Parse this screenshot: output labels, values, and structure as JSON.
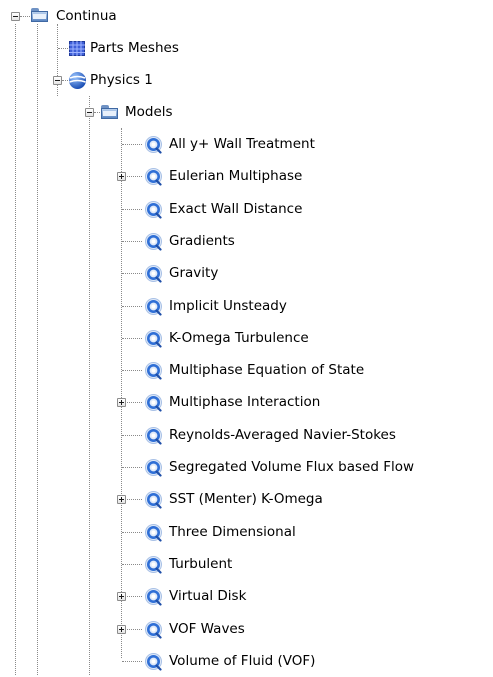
{
  "tree": {
    "continua": {
      "label": "Continua",
      "icon": "folder-icon",
      "expanded": true
    },
    "parts_meshes": {
      "label": "Parts Meshes",
      "icon": "grid-icon"
    },
    "physics": {
      "label": "Physics 1",
      "icon": "physics-sphere-icon",
      "expanded": true
    },
    "models": {
      "label": "Models",
      "icon": "folder-icon",
      "expanded": true
    },
    "model_items": [
      {
        "label": "All y+ Wall Treatment",
        "icon": "model-icon",
        "expandable": false
      },
      {
        "label": "Eulerian Multiphase",
        "icon": "model-icon",
        "expandable": true
      },
      {
        "label": "Exact Wall Distance",
        "icon": "model-icon",
        "expandable": false
      },
      {
        "label": "Gradients",
        "icon": "model-icon",
        "expandable": false
      },
      {
        "label": "Gravity",
        "icon": "model-icon",
        "expandable": false
      },
      {
        "label": "Implicit Unsteady",
        "icon": "model-icon",
        "expandable": false
      },
      {
        "label": "K-Omega Turbulence",
        "icon": "model-icon",
        "expandable": false
      },
      {
        "label": "Multiphase Equation of State",
        "icon": "model-icon",
        "expandable": false
      },
      {
        "label": "Multiphase Interaction",
        "icon": "model-icon",
        "expandable": true
      },
      {
        "label": "Reynolds-Averaged Navier-Stokes",
        "icon": "model-icon",
        "expandable": false
      },
      {
        "label": "Segregated Volume Flux based Flow",
        "icon": "model-icon",
        "expandable": false
      },
      {
        "label": "SST (Menter) K-Omega",
        "icon": "model-icon",
        "expandable": true
      },
      {
        "label": "Three Dimensional",
        "icon": "model-icon",
        "expandable": false
      },
      {
        "label": "Turbulent",
        "icon": "model-icon",
        "expandable": false
      },
      {
        "label": "Virtual Disk",
        "icon": "model-icon",
        "expandable": true
      },
      {
        "label": "VOF Waves",
        "icon": "model-icon",
        "expandable": true
      },
      {
        "label": "Volume of Fluid (VOF)",
        "icon": "model-icon",
        "expandable": false
      }
    ]
  },
  "colors": {
    "folder": "#5b86c2",
    "mesh_grid": "#3f5fd8",
    "sphere": "#2f6fd6",
    "model_ring": "#2f6fd6",
    "connector": "#8a8a8a"
  }
}
